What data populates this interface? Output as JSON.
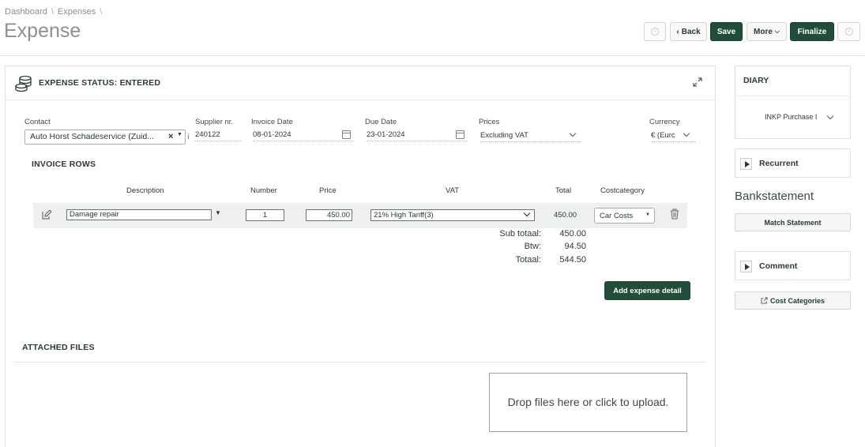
{
  "breadcrumb": {
    "items": [
      "Dashboard",
      "Expenses"
    ]
  },
  "page": {
    "title": "Expense"
  },
  "toolbar": {
    "back": "Back",
    "save": "Save",
    "more": "More",
    "finalize": "Finalize"
  },
  "status": {
    "title": "EXPENSE STATUS: ENTERED"
  },
  "fields": {
    "contact_label": "Contact",
    "contact_value": "Auto Horst Schadeservice (Zuid...",
    "supplier_label": "Supplier nr.",
    "supplier_value": "240122",
    "invoice_date_label": "Invoice Date",
    "invoice_date_value": "08-01-2024",
    "due_date_label": "Due Date",
    "due_date_value": "23-01-2024",
    "prices_label": "Prices",
    "prices_value": "Excluding VAT",
    "currency_label": "Currency",
    "currency_value": "€ (Eurc"
  },
  "invoice_rows": {
    "title": "INVOICE ROWS",
    "headers": [
      "Description",
      "Number",
      "Price",
      "VAT",
      "Total",
      "Costcategory"
    ],
    "row": {
      "description": "Damage repair",
      "number": "1",
      "price": "450.00",
      "vat": "21% High Tariff(3)",
      "total": "450.00",
      "costcategory": "Car Costs"
    }
  },
  "summary": {
    "subtotal_label": "Sub totaal:",
    "subtotal_value": "450.00",
    "btw_label": "Btw:",
    "btw_value": "94.50",
    "total_label": "Totaal:",
    "total_value": "544.50"
  },
  "add_detail": "Add expense detail",
  "attached": {
    "title": "ATTACHED FILES",
    "dropzone": "Drop files here or click to upload."
  },
  "sidebar": {
    "diary_title": "DIARY",
    "diary_value": "INKP Purchase I",
    "recurrent": "Recurrent",
    "bankstatement": "Bankstatement",
    "match_statement": "Match Statement",
    "comment": "Comment",
    "cost_categories": "Cost Categories"
  },
  "colors": {
    "accent": "#234d3b"
  }
}
